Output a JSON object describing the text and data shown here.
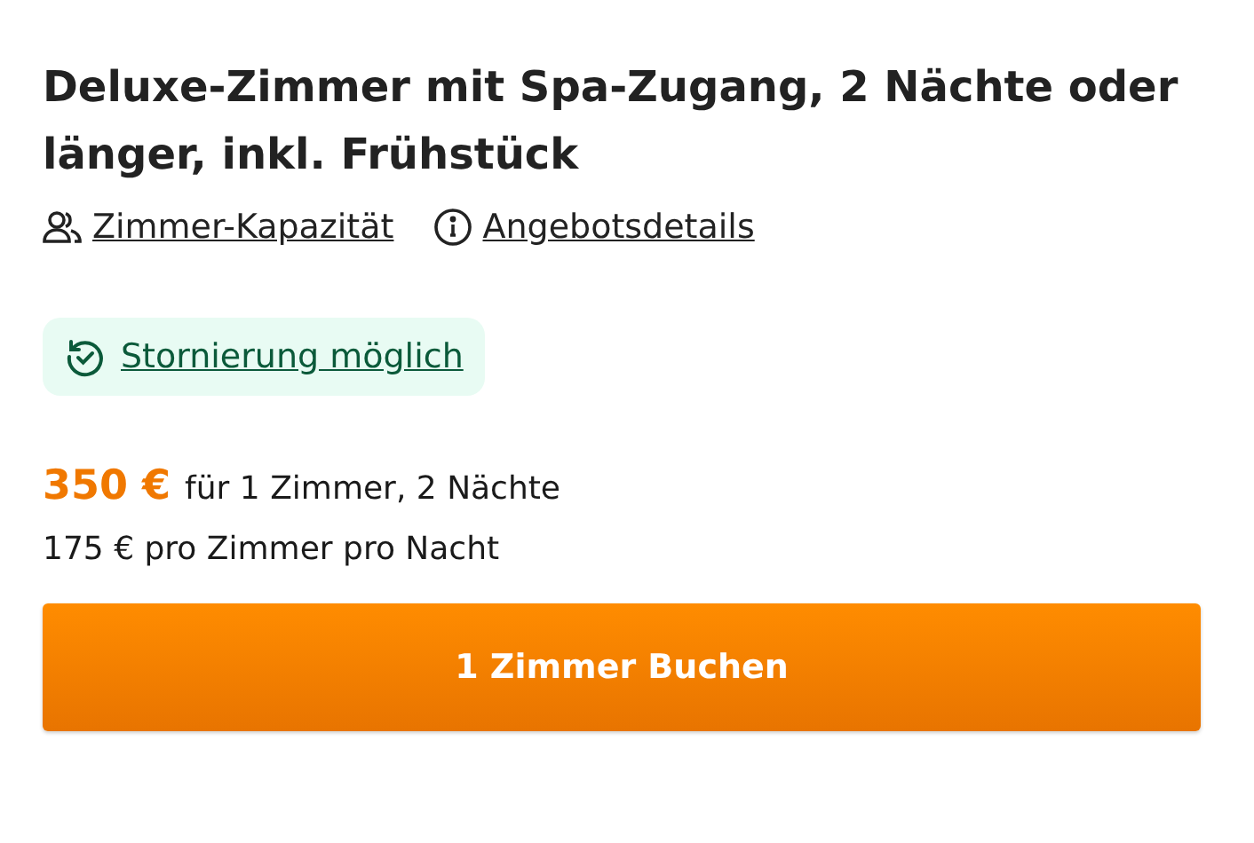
{
  "title": "Deluxe-Zimmer mit Spa-Zugang, 2 Nächte oder länger, inkl. Frühstück",
  "links": [
    {
      "kind": "people",
      "label": "Zimmer-Kapazität"
    },
    {
      "kind": "info",
      "label": "Angebotsdetails"
    }
  ],
  "cancellation": {
    "label": "Stornierung möglich"
  },
  "price": {
    "total": "350 €",
    "detail": "für 1 Zimmer, 2 Nächte",
    "per_night": "175 € pro Zimmer pro Nacht"
  },
  "book_button": "1 Zimmer Buchen"
}
